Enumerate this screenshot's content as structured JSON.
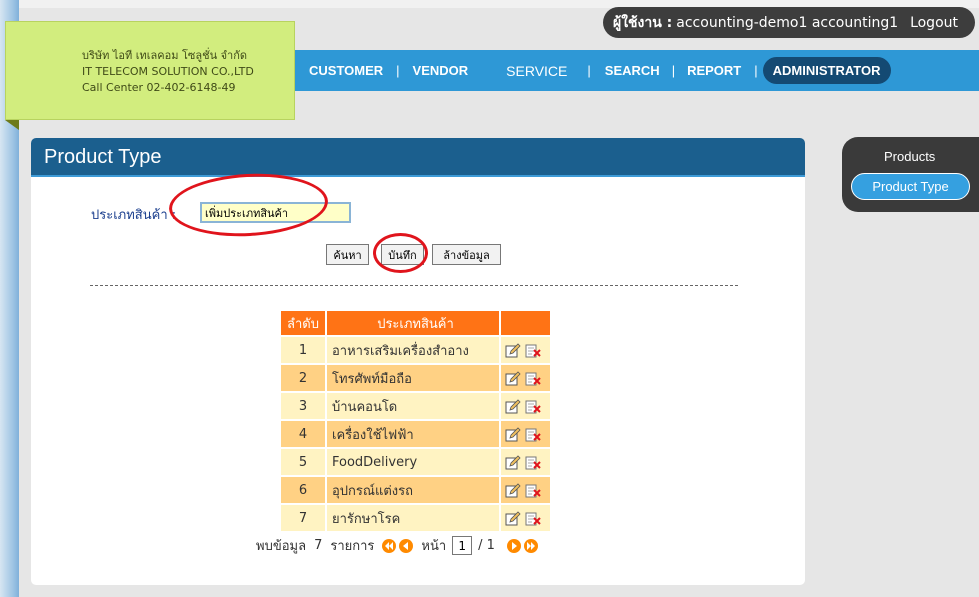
{
  "header": {
    "user_label": "ผู้ใช้งาน :",
    "user_name": "accounting-demo1 accounting1",
    "logout_label": "Logout"
  },
  "company": {
    "name_th": "บริษัท ไอที เทเลคอม โซลูชั่น จำกัด",
    "name_en": "IT TELECOM SOLUTION CO.,LTD",
    "call_center": "Call Center 02-402-6148-49"
  },
  "nav": {
    "separator": "|",
    "items": [
      {
        "label": "CUSTOMER"
      },
      {
        "label": "VENDOR"
      },
      {
        "label": "SERVICE"
      },
      {
        "label": "SEARCH"
      },
      {
        "label": "REPORT"
      },
      {
        "label": "ADMINISTRATOR",
        "active": true
      }
    ]
  },
  "panel": {
    "title": "Product Type",
    "field_label": "ประเภทสินค้า :",
    "field_value": "เพิ่มประเภทสินค้า",
    "buttons": {
      "search": "ค้นหา",
      "save": "บันทึก",
      "clear": "ล้างข้อมูล"
    }
  },
  "table": {
    "headers": [
      "ลำดับ",
      "ประเภทสินค้า",
      ""
    ],
    "rows": [
      {
        "no": "1",
        "name": "อาหารเสริมเครื่องสำอาง"
      },
      {
        "no": "2",
        "name": "โทรศัพท์มือถือ"
      },
      {
        "no": "3",
        "name": "บ้านคอนโด"
      },
      {
        "no": "4",
        "name": "เครื่องใช้ไฟฟ้า"
      },
      {
        "no": "5",
        "name": "FoodDelivery"
      },
      {
        "no": "6",
        "name": "อุปกรณ์แต่งรถ"
      },
      {
        "no": "7",
        "name": "ยารักษาโรค"
      }
    ],
    "row_icons": [
      "edit-icon",
      "delete-icon"
    ]
  },
  "pager": {
    "found_label": "พบข้อมูล",
    "count": "7",
    "items_label": "รายการ",
    "page_label": "หน้า",
    "page_value": "1",
    "total_pages": "/ 1"
  },
  "side": {
    "title": "Products",
    "active_item": "Product Type"
  },
  "colors": {
    "nav_bg": "#2e98d6",
    "panel_head": "#1b5f8e",
    "table_head": "#ff7315",
    "row_odd": "#fff3c2",
    "row_even": "#ffd184",
    "highlight": "#e0141c"
  }
}
